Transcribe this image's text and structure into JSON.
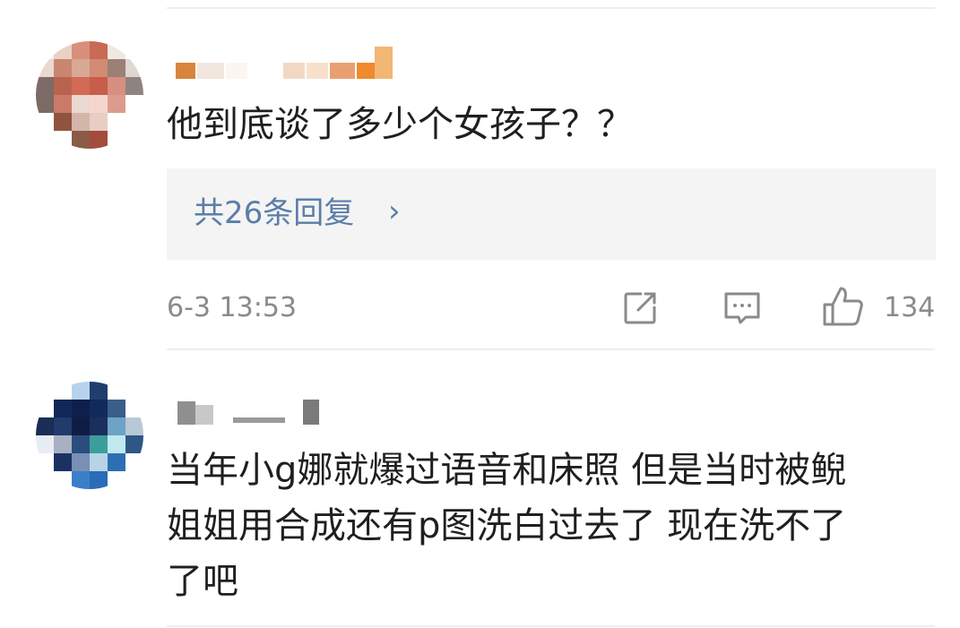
{
  "comments": [
    {
      "text": "他到底谈了多少个女孩子？？",
      "replies_link": "共26条回复",
      "chevron": "›",
      "timestamp": "6-3 13:53",
      "like_count": "134"
    },
    {
      "text_lines": [
        "当年小g娜就爆过语音和床照 但是当时被鲵",
        "姐姐用合成还有p图洗白过去了 现在洗不了",
        "了吧"
      ]
    }
  ],
  "colors": {
    "link": "#5b7ea8",
    "meta": "#8a8a8a",
    "reply_box_bg": "#f4f4f4",
    "divider": "#eeeeee"
  },
  "icons": [
    "share-icon",
    "comment-icon",
    "like-icon"
  ]
}
